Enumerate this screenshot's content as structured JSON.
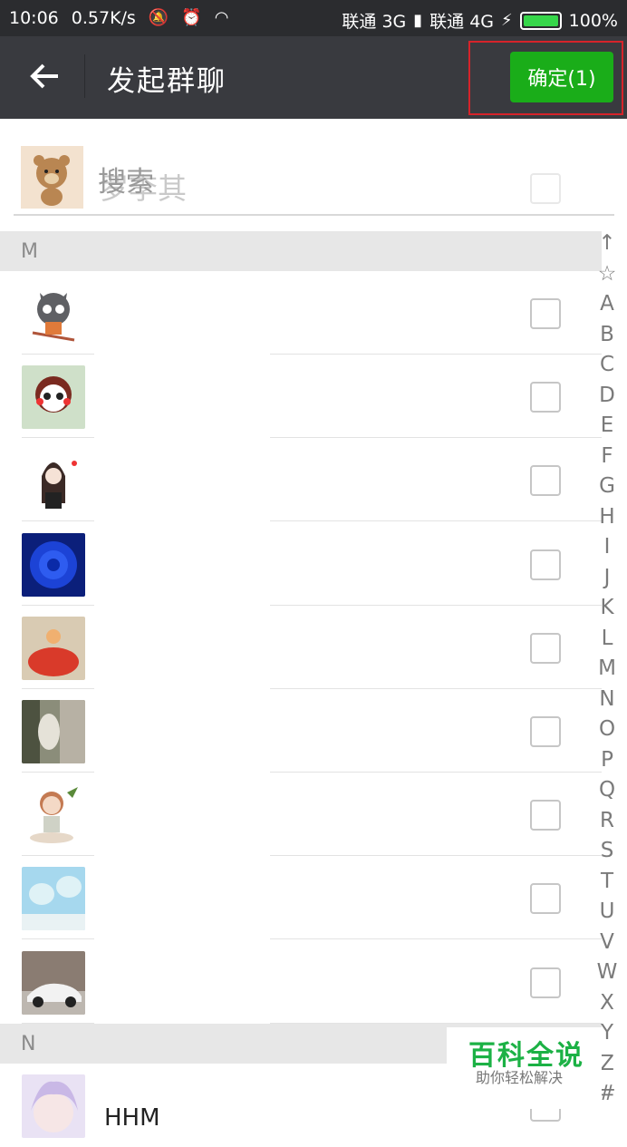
{
  "status_bar": {
    "time": "10:06",
    "speed": "0.57K/s",
    "carrier1": "联通 3G",
    "carrier2": "联通 4G",
    "battery": "100%"
  },
  "header": {
    "title": "发起群聊",
    "confirm_label": "确定(1)"
  },
  "search": {
    "placeholder": "搜索",
    "ghost_name": "罗李其"
  },
  "sections": [
    {
      "letter": "M"
    },
    {
      "letter": "N"
    }
  ],
  "index": [
    "↑",
    "☆",
    "A",
    "B",
    "C",
    "D",
    "E",
    "F",
    "G",
    "H",
    "I",
    "J",
    "K",
    "L",
    "M",
    "N",
    "O",
    "P",
    "Q",
    "R",
    "S",
    "T",
    "U",
    "V",
    "W",
    "X",
    "Y",
    "Z",
    "#"
  ],
  "contacts_m": [
    {
      "icon": "cartoon-wolf-avatar",
      "color": "#6a6b70"
    },
    {
      "icon": "cartoon-monkey-avatar",
      "color": "#c2473e"
    },
    {
      "icon": "girl-sketch-avatar",
      "color": "#3a2a2a"
    },
    {
      "icon": "blue-rose-avatar",
      "color": "#1537b8"
    },
    {
      "icon": "red-dress-avatar",
      "color": "#d64536"
    },
    {
      "icon": "tree-photo-avatar",
      "color": "#6b6c5a"
    },
    {
      "icon": "yoga-girl-avatar",
      "color": "#d49a7a"
    },
    {
      "icon": "sky-cartoon-avatar",
      "color": "#8cc8e6"
    },
    {
      "icon": "white-car-avatar",
      "color": "#9a8f88"
    }
  ],
  "contacts_n": [
    {
      "icon": "anime-girl-avatar",
      "color": "#cfc3e6",
      "name": "HHM"
    }
  ],
  "watermark": {
    "big": "百科全说",
    "small": "助你轻松解决"
  }
}
